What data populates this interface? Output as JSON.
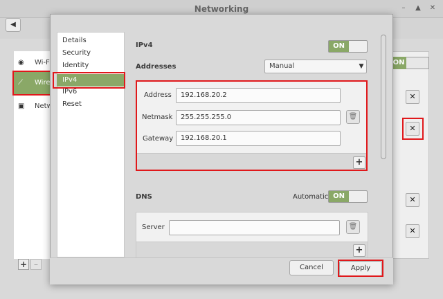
{
  "background_window": {
    "title": "Networking",
    "wm_buttons": [
      "–",
      "▲",
      "✕"
    ],
    "back_icon": "◀",
    "sidebar": [
      {
        "icon": "wifi-icon",
        "glyph": "◉",
        "label": "Wi-Fi"
      },
      {
        "icon": "wired-icon",
        "glyph": "⟋",
        "label": "Wired"
      },
      {
        "icon": "network-icon",
        "glyph": "▣",
        "label": "Network proxy"
      }
    ],
    "on_label": "ON",
    "settings_glyph": "✕",
    "add_glyph": "+",
    "remove_glyph": "–"
  },
  "dialog": {
    "nav": [
      "Details",
      "Security",
      "Identity",
      "IPv4",
      "IPv6",
      "Reset"
    ],
    "selected_nav": "IPv4",
    "ipv4": {
      "title": "IPv4",
      "toggle": "ON",
      "addresses_label": "Addresses",
      "method": "Manual",
      "address_label": "Address",
      "address_value": "192.168.20.2",
      "netmask_label": "Netmask",
      "netmask_value": "255.255.255.0",
      "gateway_label": "Gateway",
      "gateway_value": "192.168.20.1",
      "add_glyph": "+"
    },
    "dns": {
      "title": "DNS",
      "automatic_label": "Automatic",
      "toggle": "ON",
      "server_label": "Server",
      "server_value": "",
      "add_glyph": "+"
    },
    "footer": {
      "cancel": "Cancel",
      "apply": "Apply"
    }
  },
  "colors": {
    "accent_green": "#8aa867",
    "highlight_red": "#e0181b"
  }
}
